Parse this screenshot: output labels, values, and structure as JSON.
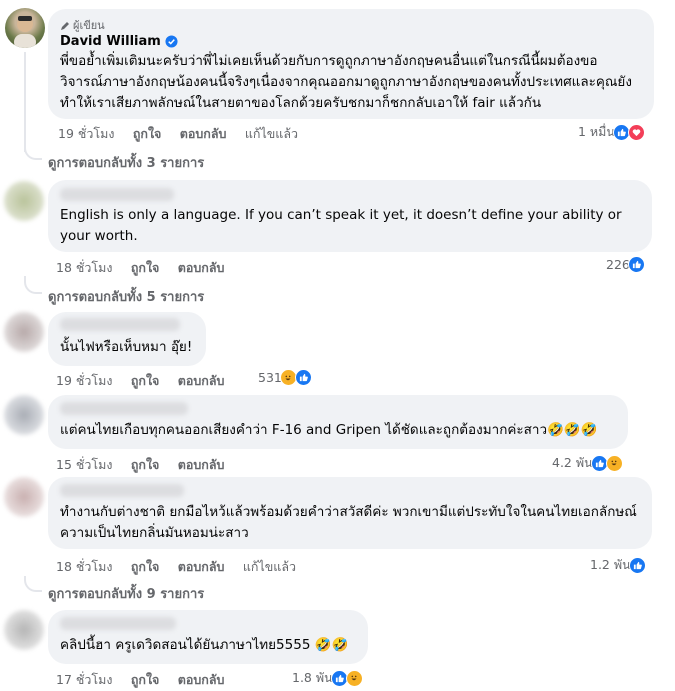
{
  "main_comment": {
    "badge_label": "ผู้เขียน",
    "author_name": "David William",
    "verified": true,
    "text": "พี่ขอย้ำเพิ่มเติมนะครับว่าพี่ไม่เคยเห็นด้วยกับการดูถูกภาษาอังกฤษคนอื่นแต่ในกรณีนี้ผมต้องขอวิจารณ์ภาษาอังกฤษน้องคนนี้จริงๆเนื่องจากคุณออกมาดูถูกภาษาอังกฤษของคนทั้งประเทศและคุณยังทำให้เราเสียภาพลักษณ์ในสายตาของโลกด้วยครับชกมาก็ชกกลับเอาให้ fair แล้วกัน",
    "time": "19 ชั่วโมง",
    "like_label": "ถูกใจ",
    "reply_label": "ตอบกลับ",
    "edited_label": "แก้ไขแล้ว",
    "reaction_count": "1 หมื่น",
    "view_replies": "ดูการตอบกลับทั้ง 3 รายการ"
  },
  "comments": [
    {
      "text": "English is only a language. If you can’t speak it yet, it doesn’t define your ability or your worth.",
      "time": "18 ชั่วโมง",
      "like_label": "ถูกใจ",
      "reply_label": "ตอบกลับ",
      "reaction_count": "226",
      "reactions": [
        "like"
      ],
      "view_replies": "ดูการตอบกลับทั้ง 5 รายการ"
    },
    {
      "text": "นั้นไฟหรือเห็บหมา อุ๊ย!",
      "time": "19 ชั่วโมง",
      "like_label": "ถูกใจ",
      "reply_label": "ตอบกลับ",
      "reaction_count": "531",
      "reactions": [
        "haha",
        "like"
      ]
    },
    {
      "text": "แต่คนไทยเกือบทุกคนออกเสียงคำว่า F-16 and Gripen ได้ชัดและถูกต้องมากค่ะสาว🤣🤣🤣",
      "time": "15 ชั่วโมง",
      "like_label": "ถูกใจ",
      "reply_label": "ตอบกลับ",
      "reaction_count": "4.2 พัน",
      "reactions": [
        "like",
        "haha"
      ]
    },
    {
      "text": "ทำงานกับต่างชาติ ยกมือไหว้แล้วพร้อมด้วยคำว่าสวัสดีค่ะ พวกเขามีแต่ประทับใจในคนไทยเอกลักษณ์ความเป็นไทยกลิ่นมันหอมน่ะสาว",
      "time": "18 ชั่วโมง",
      "like_label": "ถูกใจ",
      "reply_label": "ตอบกลับ",
      "edited_label": "แก้ไขแล้ว",
      "reaction_count": "1.2 พัน",
      "reactions": [
        "like"
      ],
      "view_replies": "ดูการตอบกลับทั้ง 9 รายการ"
    },
    {
      "text": "คลิปนี้ฮา ครูเดวิดสอนได้ยันภาษาไทย5555 🤣🤣",
      "time": "17 ชั่วโมง",
      "like_label": "ถูกใจ",
      "reply_label": "ตอบกลับ",
      "reaction_count": "1.8 พัน",
      "reactions": [
        "like",
        "haha"
      ]
    }
  ],
  "colors": {
    "bubble": "#f0f2f5",
    "muted": "#65676b",
    "like": "#1877f2",
    "love": "#f33e58",
    "haha": "#f7b125"
  }
}
